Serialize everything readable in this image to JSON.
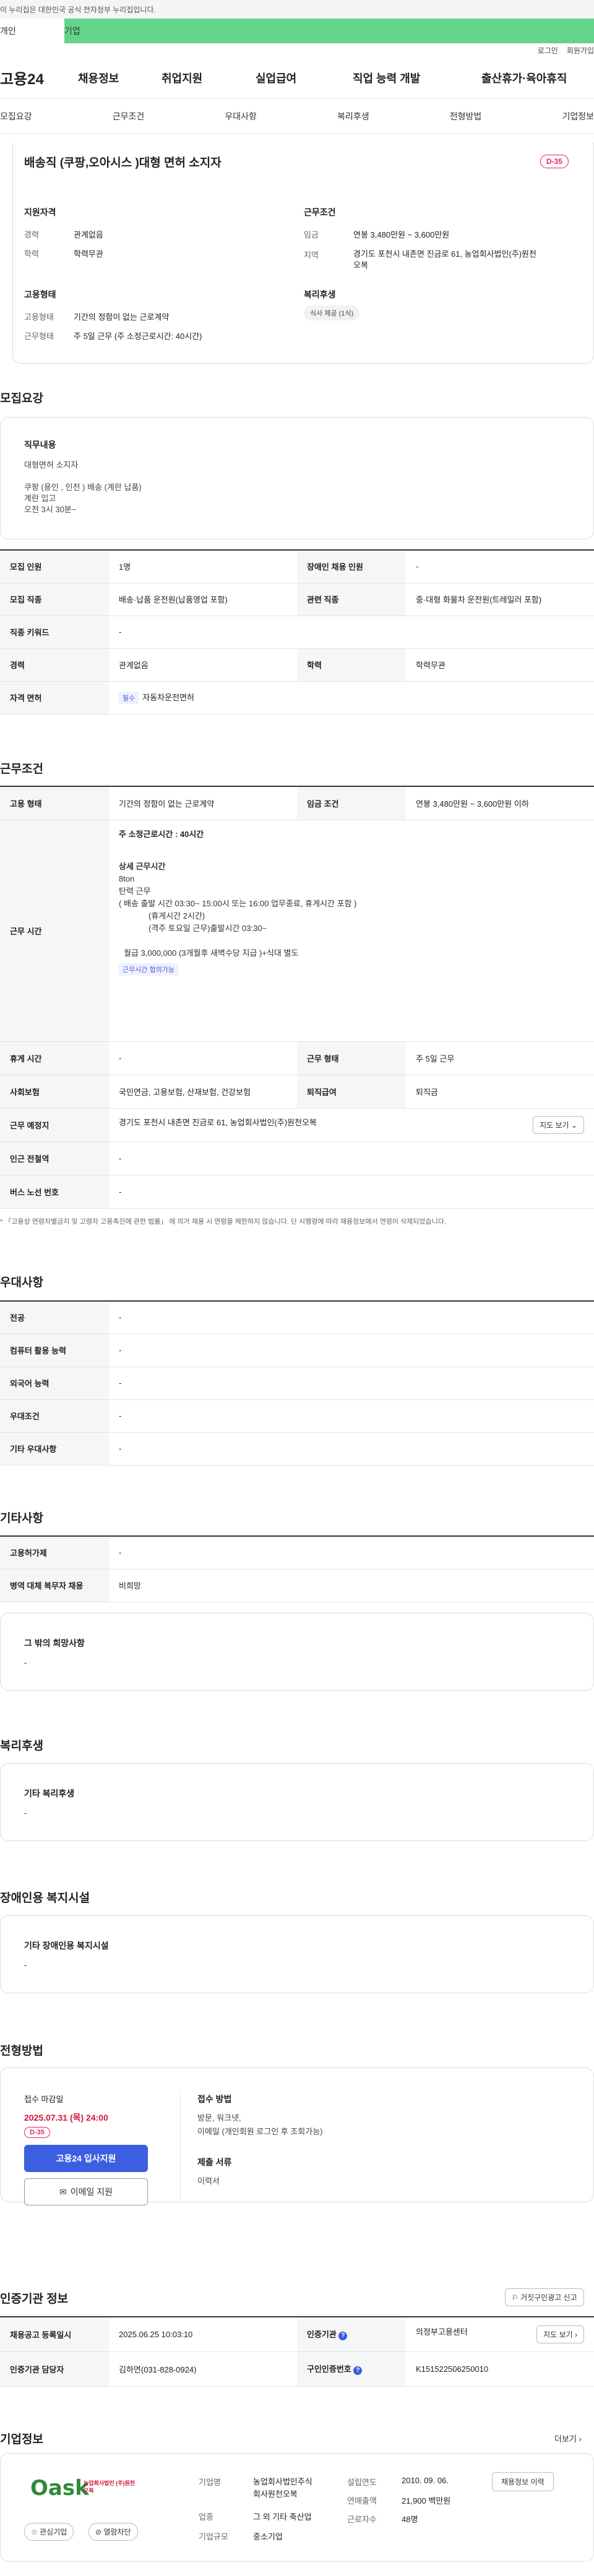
{
  "topbar": {
    "notice": "이 누리집은 대한민국 공식 전자정부 누리집입니다."
  },
  "gnb": {
    "left": "개인",
    "right": "기업"
  },
  "util": {
    "login": "로그인",
    "join": "회원가입"
  },
  "header": {
    "logo": "고용24",
    "nav": [
      "채용정보",
      "취업지원",
      "실업급여",
      "직업 능력 개발",
      "출산휴가·육아휴직"
    ]
  },
  "subnav": [
    "모집요강",
    "근무조건",
    "우대사항",
    "복리후생",
    "전형방법",
    "기업정보"
  ],
  "summary": {
    "title": "배송직 (쿠팡,오아시스 )대형 면허 소지자",
    "dday": "D-35",
    "qual_title": "지원자격",
    "exp_label": "경력",
    "exp_value": "관계없음",
    "edu_label": "학력",
    "edu_value": "학력무관",
    "cond_title": "근무조건",
    "wage_label": "임금",
    "wage_value": "연봉 3,480만원 ~ 3,600만원",
    "region_label": "지역",
    "region_value_1": "경기도 포천시 내촌면 진금로 61, 농업회사법인(주)원천",
    "region_value_2": "오복",
    "form_title": "고용형태",
    "emp_label": "고용형태",
    "emp_value": "기간의 정함이 없는 근로계약",
    "work_label": "근무형태",
    "work_value": "주 5일 근무 (주 소정근로시간: 40시간)",
    "welfare_title": "복리후생",
    "welfare_tag": "식사 제공 (1식)"
  },
  "recruit": {
    "heading": "모집요강",
    "job_title": "직무내용",
    "job_lines": [
      "대형면허 소지자",
      "",
      "쿠팡 (용인 , 인천 ) 배송 (계란 납품)",
      "계란 입고",
      "오전 3시 30분~"
    ],
    "rows": {
      "headcount_label": "모집 인원",
      "headcount_value": "1명",
      "disabled_label": "장애인 채용 인원",
      "disabled_value": "-",
      "occupation_label": "모집 직종",
      "occupation_value": "배송·납품 운전원(납품영업 포함)",
      "related_label": "관련 직종",
      "related_value": "중·대형 화물차 운전원(트레일러 포함)",
      "keyword_label": "직종 키워드",
      "keyword_value": "-",
      "career_label": "경력",
      "career_value": "관계없음",
      "edu_label": "학력",
      "edu_value": "학력무관",
      "license_label": "자격 면허",
      "license_tag": "필수",
      "license_value": "자동차운전면허"
    }
  },
  "workcond": {
    "heading": "근무조건",
    "emp_label": "고용 형태",
    "emp_value": "기간의 정함이 없는 근로계약",
    "wage_label": "임금 조건",
    "wage_value": "연봉 3,480만원 ~ 3,600만원 이하",
    "hours_label": "근무 시간",
    "hours_main": "주 소정근로시간 : 40시간",
    "hours_lines": [
      "상세 근무시간",
      "8ton",
      "탄력 근무",
      "( 배송 출발 시간 03:30~ 15:00시 또는 16:00 업무종료, 휴게시간 포함 )",
      "(휴게시간 2시간)",
      "(격주 토요일 근무)출발시간 03:30~",
      "",
      "월급 3,000,000 (3개월후 새벽수당  지급 )+식대 별도"
    ],
    "hours_tag": "근무시간 협의가능",
    "break_label": "휴게 시간",
    "break_value": "-",
    "form_label": "근무 형태",
    "form_value": "주 5일 근무",
    "insurance_label": "사회보험",
    "insurance_value": "국민연금, 고용보험, 산재보험, 건강보험",
    "retire_label": "퇴직급여",
    "retire_value": "퇴직금",
    "place_label": "근무 예정지",
    "place_value": "경기도 포천시 내촌면 진금로 61, 농업회사법인(주)원천오복",
    "map_btn": "지도 보기",
    "subway_label": "인근 전철역",
    "subway_value": "-",
    "bus_label": "버스 노선 번호",
    "bus_value": "-",
    "note": "* 「고용상 연령차별금지 및 고령자 고용촉진에 관한 법률」 에 의거 채용 시 연령을 제한하지 않습니다. 단 시행령에 따라 채용정보에서 연령이 삭제되었습니다."
  },
  "prefer": {
    "heading": "우대사항",
    "rows": [
      {
        "label": "전공",
        "value": "-"
      },
      {
        "label": "컴퓨터 활용 능력",
        "value": "-"
      },
      {
        "label": "외국어 능력",
        "value": "-"
      },
      {
        "label": "우대조건",
        "value": "-"
      },
      {
        "label": "기타 우대사항",
        "value": "-"
      }
    ]
  },
  "other": {
    "heading": "기타사항",
    "rows": [
      {
        "label": "고용허가제",
        "value": "-"
      },
      {
        "label": "병역 대체 복무자 채용",
        "value": "비희망"
      }
    ],
    "box_title": "그 밖의 희망사항",
    "box_value": "-"
  },
  "welfare": {
    "heading": "복리후생",
    "box_title": "기타 복리후생",
    "box_value": "-"
  },
  "disabled": {
    "heading": "장애인용 복지시설",
    "box_title": "기타 장애인용 복지시설",
    "box_value": "-"
  },
  "selection": {
    "heading": "전형방법",
    "deadline_label": "접수 마감일",
    "deadline_value": "2025.07.31 (목) 24:00",
    "dday": "D-35",
    "apply_btn": "고용24 입사지원",
    "email_btn": "이메일 지원",
    "method_label": "접수 방법",
    "method_lines": [
      "방문, 워크넷,",
      "이메일 (개인회원 로그인 후 조회가능)"
    ],
    "docs_label": "제출 서류",
    "docs_value": "이력서"
  },
  "cert": {
    "heading": "인증기관 정보",
    "report_btn": "거짓구인광고 신고",
    "reg_label": "채용공고 등록일시",
    "reg_value": "2025.06.25 10:03:10",
    "org_label": "인증기관",
    "org_value": "의정부고용센터",
    "map_btn": "지도 보기",
    "manager_label": "인증기관 담당자",
    "manager_value": "김하연(031-828-0924)",
    "id_label": "구인인증번호",
    "id_value": "K151522506250010"
  },
  "company": {
    "heading": "기업정보",
    "more": "더보기",
    "logo_text": "Oask",
    "logo_sub": "농업회사법인 (주)원천오복",
    "fav_btn": "관심기업",
    "block_btn": "열람차단",
    "name_label": "기업명",
    "name_value_1": "농업회사법인주식",
    "name_value_2": "회사원천오복",
    "industry_label": "업종",
    "industry_value": "그 외 기타 축산업",
    "size_label": "기업규모",
    "size_value": "중소기업",
    "founded_label": "설립연도",
    "founded_value": "2010. 09. 06.",
    "sales_label": "연매출액",
    "sales_value": "21,900 백만원",
    "employees_label": "근로자수",
    "employees_value": "48명",
    "jobs_btn": "채용정보 이력"
  },
  "colors": {
    "green": "#63d48a",
    "blue": "#3c5ee0",
    "pink": "#e1246e",
    "red": "#d3143c"
  }
}
